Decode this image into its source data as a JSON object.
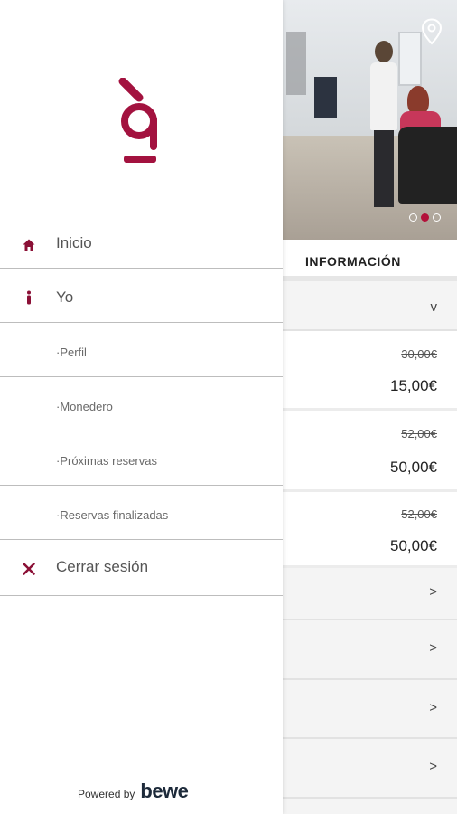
{
  "colors": {
    "brand": "#a3123f",
    "accent_dot": "#b3113a",
    "text_dark": "#222222",
    "text_menu": "#555555"
  },
  "drawer": {
    "logo_icon": "salon-logo-icon",
    "menu": [
      {
        "label": "Inicio",
        "icon": "home-icon"
      },
      {
        "label": "Yo",
        "icon": "person-icon"
      },
      {
        "label": "·Perfil"
      },
      {
        "label": "·Monedero"
      },
      {
        "label": "·Próximas reservas"
      },
      {
        "label": "·Reservas finalizadas"
      },
      {
        "label": "Cerrar sesión",
        "icon": "close-icon"
      }
    ],
    "powered_by": "Powered by",
    "powered_brand": "bewe"
  },
  "main": {
    "hero": {
      "location_icon": "location-pin-icon",
      "carousel_total": 3,
      "carousel_active": 2
    },
    "info_title": "INFORMACIÓN",
    "accordion_chevron": "v",
    "prices": [
      {
        "old": "30,00€",
        "new": "15,00€"
      },
      {
        "old": "52,00€",
        "new": "50,00€"
      },
      {
        "old": "52,00€",
        "new": "50,00€"
      }
    ],
    "rows_chevron": ">"
  }
}
